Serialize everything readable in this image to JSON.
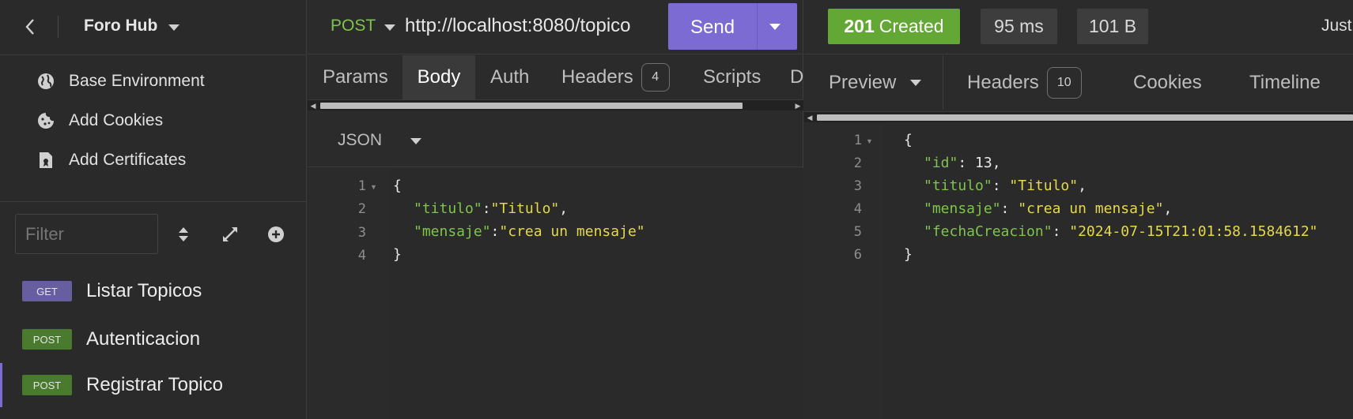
{
  "sidebar": {
    "project_name": "Foro Hub",
    "menu": [
      {
        "label": "Base Environment",
        "icon": "globe-icon"
      },
      {
        "label": "Add Cookies",
        "icon": "cookie-icon"
      },
      {
        "label": "Add Certificates",
        "icon": "certificate-icon"
      }
    ],
    "filter_placeholder": "Filter",
    "requests": [
      {
        "method": "GET",
        "name": "Listar Topicos"
      },
      {
        "method": "POST",
        "name": "Autenticacion"
      },
      {
        "method": "POST",
        "name": "Registrar Topico",
        "active": true
      }
    ]
  },
  "request": {
    "method": "POST",
    "url": "http://localhost:8080/topico",
    "send_label": "Send",
    "tabs": [
      {
        "label": "Params"
      },
      {
        "label": "Body",
        "active": true
      },
      {
        "label": "Auth"
      },
      {
        "label": "Headers",
        "count": "4"
      },
      {
        "label": "Scripts"
      },
      {
        "label": "D"
      }
    ],
    "body_type": "JSON",
    "body_lines": [
      {
        "num": "1",
        "text": "{"
      },
      {
        "num": "2",
        "key": "\"titulo\"",
        "sep": ":",
        "value": "\"Titulo\"",
        "end": ","
      },
      {
        "num": "3",
        "key": "\"mensaje\"",
        "sep": ":",
        "value": "\"crea un mensaje\"",
        "end": ""
      },
      {
        "num": "4",
        "text": "}"
      }
    ]
  },
  "response": {
    "status_code": "201",
    "status_text": "Created",
    "time": "95 ms",
    "size": "101 B",
    "timestamp_fragment": "Just",
    "tabs": [
      {
        "label": "Preview"
      },
      {
        "label": "Headers",
        "count": "10"
      },
      {
        "label": "Cookies"
      },
      {
        "label": "Timeline"
      }
    ],
    "body_lines": [
      {
        "num": "1",
        "text": "{"
      },
      {
        "num": "2",
        "key": "\"id\"",
        "sep": ": ",
        "value": "13",
        "end": ",",
        "numeric": true
      },
      {
        "num": "3",
        "key": "\"titulo\"",
        "sep": ": ",
        "value": "\"Titulo\"",
        "end": ","
      },
      {
        "num": "4",
        "key": "\"mensaje\"",
        "sep": ": ",
        "value": "\"crea un mensaje\"",
        "end": ","
      },
      {
        "num": "5",
        "key": "\"fechaCreacion\"",
        "sep": ": ",
        "value": "\"2024-07-15T21:01:58.1584612\"",
        "end": ""
      },
      {
        "num": "6",
        "text": "}"
      }
    ]
  },
  "colors": {
    "accent": "#7b6bd3",
    "success": "#63a834",
    "json_key": "#7fc44b",
    "json_string": "#e5d94a",
    "get_badge": "#665e9e",
    "post_badge": "#4a7a2e"
  }
}
